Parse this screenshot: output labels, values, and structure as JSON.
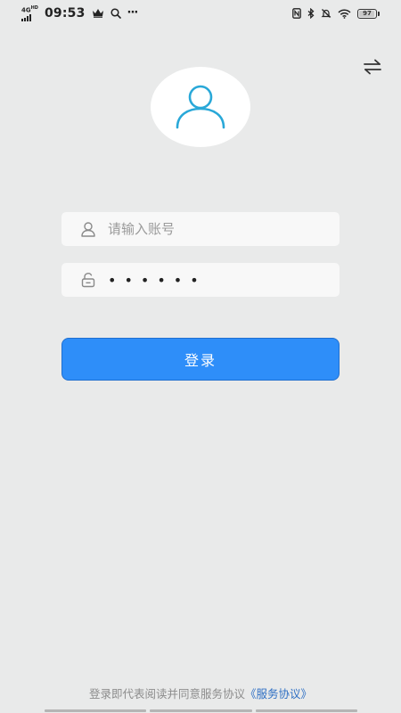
{
  "status_bar": {
    "network": "4G",
    "network_sub": "HD",
    "time": "09:53",
    "more": "···",
    "battery": "97",
    "battery_level": 0.97
  },
  "icons": {
    "crown": "crown-icon",
    "search": "search-icon",
    "nfc": "nfc-icon",
    "bluetooth": "bluetooth-icon",
    "mute": "bell-off-icon",
    "wifi": "wifi-icon",
    "switch": "swap-arrows-icon",
    "avatar": "user-icon",
    "account": "user-icon",
    "password": "lock-icon"
  },
  "login": {
    "account_placeholder": "请输入账号",
    "account_value": "",
    "password_value": "••••••",
    "button_label": "登录"
  },
  "agreement": {
    "prefix": "登录即代表阅读并同意服务协议",
    "link": "《服务协议》"
  },
  "colors": {
    "background": "#e9eaea",
    "primary": "#2e8ef9",
    "avatar_stroke": "#29a8d8",
    "link": "#2e6fc4"
  }
}
